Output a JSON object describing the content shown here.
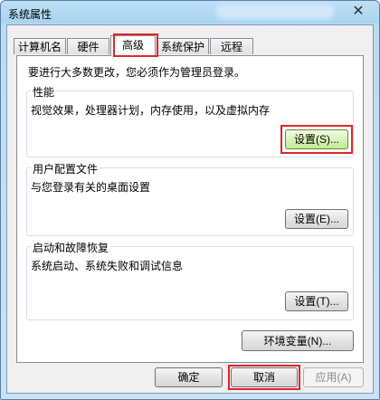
{
  "window": {
    "title": "系统属性",
    "close_icon": "✕"
  },
  "tabs": [
    {
      "label": "计算机名"
    },
    {
      "label": "硬件"
    },
    {
      "label": "高级",
      "active": true
    },
    {
      "label": "系统保护"
    },
    {
      "label": "远程"
    }
  ],
  "advanced": {
    "admin_notice": "要进行大多数更改，您必须作为管理员登录。",
    "performance": {
      "title": "性能",
      "description": "视觉效果，处理器计划，内存使用，以及虚拟内存",
      "button": "设置(S)..."
    },
    "user_profiles": {
      "title": "用户配置文件",
      "description": "与您登录有关的桌面设置",
      "button": "设置(E)..."
    },
    "startup_recovery": {
      "title": "启动和故障恢复",
      "description": "系统启动、系统失败和调试信息",
      "button": "设置(T)..."
    },
    "env_button": "环境变量(N)..."
  },
  "footer": {
    "ok": "确定",
    "cancel": "取消",
    "apply": "应用(A)"
  },
  "colors": {
    "highlight": "#e0262b",
    "accent_green": "#c3ea92"
  }
}
